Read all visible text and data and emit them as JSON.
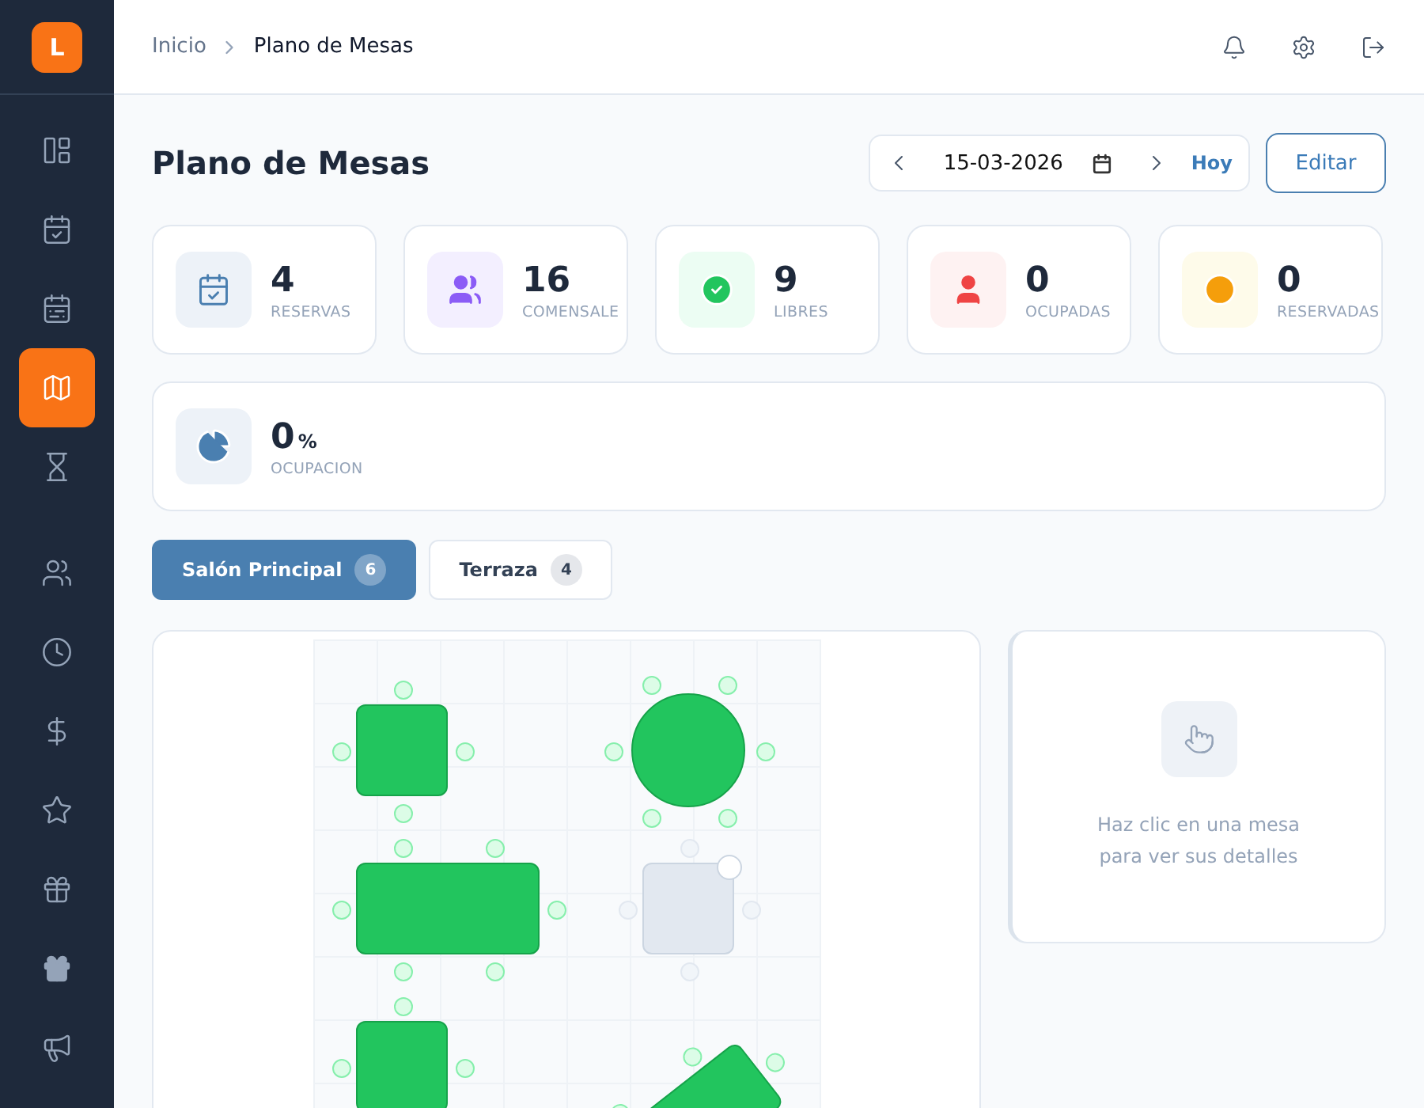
{
  "sidebar": {
    "logo": "L",
    "items": [
      {
        "selected": false
      },
      {
        "selected": false
      },
      {
        "selected": false
      },
      {
        "selected": true
      },
      {
        "selected": false
      },
      {
        "selected": false
      },
      {
        "selected": false
      },
      {
        "selected": false
      },
      {
        "selected": false
      },
      {
        "selected": false
      },
      {
        "selected": false
      },
      {
        "selected": false
      }
    ]
  },
  "breadcrumb": [
    "Inicio",
    "Plano de Mesas"
  ],
  "page_title": "Plano de Mesas",
  "date_picker": {
    "value": "15-03-2026",
    "today": "Hoy"
  },
  "edit_button": "Editar",
  "stats": [
    {
      "kind": "reservas",
      "value": "4",
      "label": "RESERVAS"
    },
    {
      "kind": "comensales",
      "value": "16",
      "label": "COMENSALE"
    },
    {
      "kind": "libres",
      "value": "9",
      "label": "LIBRES"
    },
    {
      "kind": "ocupadas",
      "value": "0",
      "label": "OCUPADAS"
    },
    {
      "kind": "reservadas",
      "value": "0",
      "label": "RESERVADAS"
    }
  ],
  "occupancy": {
    "value": "0",
    "unit": "%",
    "label": "OCUPACION"
  },
  "zones": [
    {
      "name": "Salón Principal",
      "count": "6",
      "selected": true
    },
    {
      "name": "Terraza",
      "count": "4",
      "selected": false
    }
  ],
  "tables": [
    {
      "kind": "square",
      "available": true,
      "rotated": false
    },
    {
      "kind": "round",
      "available": true,
      "rotated": false
    },
    {
      "kind": "rect",
      "available": true,
      "rotated": false
    },
    {
      "kind": "square",
      "available": false,
      "rotated": false
    },
    {
      "kind": "square",
      "available": true,
      "rotated": false
    },
    {
      "kind": "rect",
      "available": true,
      "rotated": true
    }
  ],
  "detail_panel": {
    "hint": "Haz clic en una mesa para ver sus detalles"
  }
}
